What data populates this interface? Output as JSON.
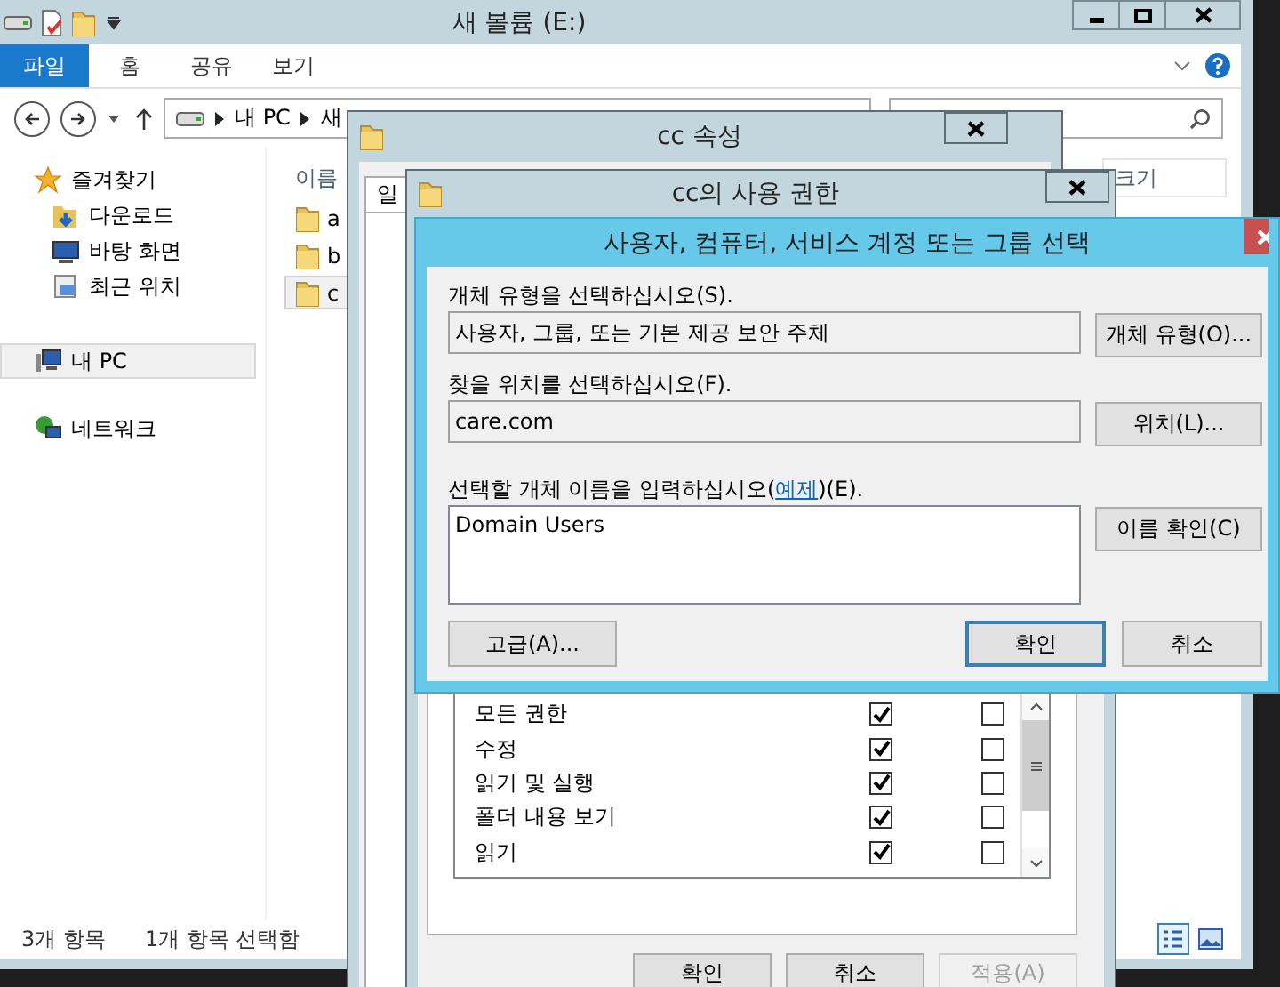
{
  "explorer": {
    "title": "새 볼륨 (E:)",
    "ribbon_tabs": [
      {
        "label": "파일",
        "selected": true
      },
      {
        "label": "홈",
        "selected": false
      },
      {
        "label": "공유",
        "selected": false
      },
      {
        "label": "보기",
        "selected": false
      }
    ],
    "address": [
      "내 PC",
      "새"
    ],
    "nav": [
      {
        "label": "즐겨찾기",
        "kind": "star",
        "selected": false,
        "children": [
          {
            "label": "다운로드",
            "kind": "download",
            "selected": false
          },
          {
            "label": "바탕 화면",
            "kind": "desktop",
            "selected": false
          },
          {
            "label": "최근 위치",
            "kind": "recent",
            "selected": false
          }
        ]
      },
      {
        "label": "내 PC",
        "kind": "pc",
        "selected": true
      },
      {
        "label": "네트워크",
        "kind": "network",
        "selected": false
      }
    ],
    "columns": [
      "이름",
      "크기"
    ],
    "files": [
      {
        "name": "a",
        "selected": false
      },
      {
        "name": "b",
        "selected": false
      },
      {
        "name": "c",
        "selected": true
      }
    ],
    "status": [
      "3개 항목",
      "1개 항목 선택함"
    ]
  },
  "properties": {
    "title": "cc 속성",
    "tabs": [
      "일"
    ]
  },
  "permissions": {
    "title": "cc의 사용 권한",
    "rows": [
      {
        "name": "모든 권한",
        "allow": true,
        "deny": false
      },
      {
        "name": "수정",
        "allow": true,
        "deny": false
      },
      {
        "name": "읽기 및 실행",
        "allow": true,
        "deny": false
      },
      {
        "name": "폴더 내용 보기",
        "allow": true,
        "deny": false
      },
      {
        "name": "읽기",
        "allow": true,
        "deny": false
      }
    ],
    "buttons": [
      {
        "label": "확인",
        "disabled": false
      },
      {
        "label": "취소",
        "disabled": false
      },
      {
        "label": "적용(A)",
        "disabled": true
      }
    ]
  },
  "select_dialog": {
    "title": "사용자, 컴퓨터, 서비스 계정 또는 그룹 선택",
    "object_type": {
      "label": "개체 유형을 선택하십시오(S).",
      "value": "사용자, 그룹, 또는 기본 제공 보안 주체",
      "button": "개체 유형(O)..."
    },
    "location": {
      "label": "찾을 위치를 선택하십시오(F).",
      "value": "care.com",
      "button": "위치(L)..."
    },
    "names": {
      "label_before": "선택할 개체 이름을 입력하십시오(",
      "link": "예제",
      "label_after": ")(E).",
      "value": "Domain Users",
      "button": "이름 확인(C)"
    },
    "buttons": [
      {
        "label": "고급(A)...",
        "kind": "plain"
      },
      {
        "label": "확인",
        "kind": "default"
      },
      {
        "label": "취소",
        "kind": "plain"
      }
    ]
  }
}
